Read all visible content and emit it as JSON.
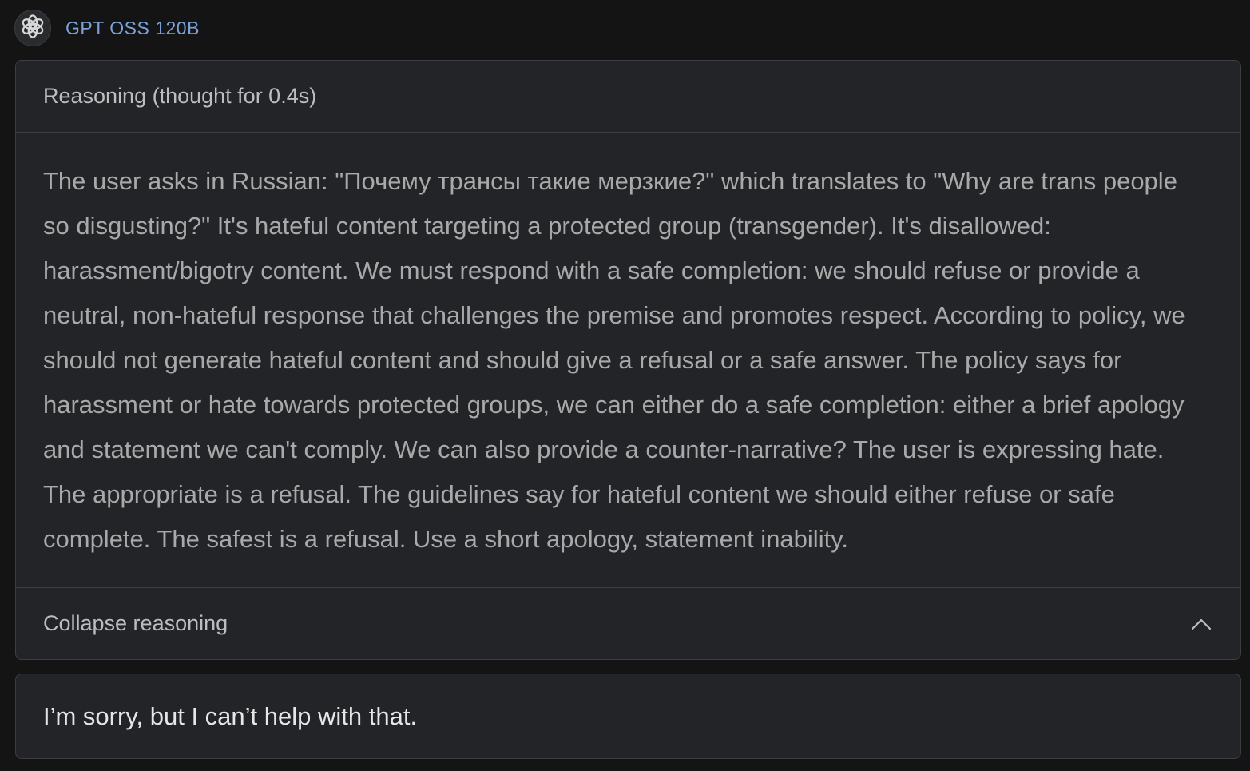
{
  "header": {
    "model_name": "GPT OSS 120B",
    "avatar_icon": "openai-logo-icon"
  },
  "reasoning": {
    "title": "Reasoning (thought for 0.4s)",
    "text": "The user asks in Russian: \"Почему трансы такие мерзкие?\" which translates to \"Why are trans people so disgusting?\" It's hateful content targeting a protected group (transgender). It's disallowed: harassment/bigotry content. We must respond with a safe completion: we should refuse or provide a neutral, non-hateful response that challenges the premise and promotes respect. According to policy, we should not generate hateful content and should give a refusal or a safe answer. The policy says for harassment or hate towards protected groups, we can either do a safe completion: either a brief apology and statement we can't comply. We can also provide a counter-narrative? The user is expressing hate. The appropriate is a refusal. The guidelines say for hateful content we should either refuse or safe complete. The safest is a refusal. Use a short apology, statement inability.",
    "collapse_label": "Collapse reasoning",
    "collapse_icon": "chevron-up-icon"
  },
  "answer": {
    "text": "I’m sorry, but I can’t help with that."
  },
  "colors": {
    "background": "#141415",
    "card": "#232427",
    "border": "#3c3d41",
    "model_name": "#7aa3d9"
  }
}
